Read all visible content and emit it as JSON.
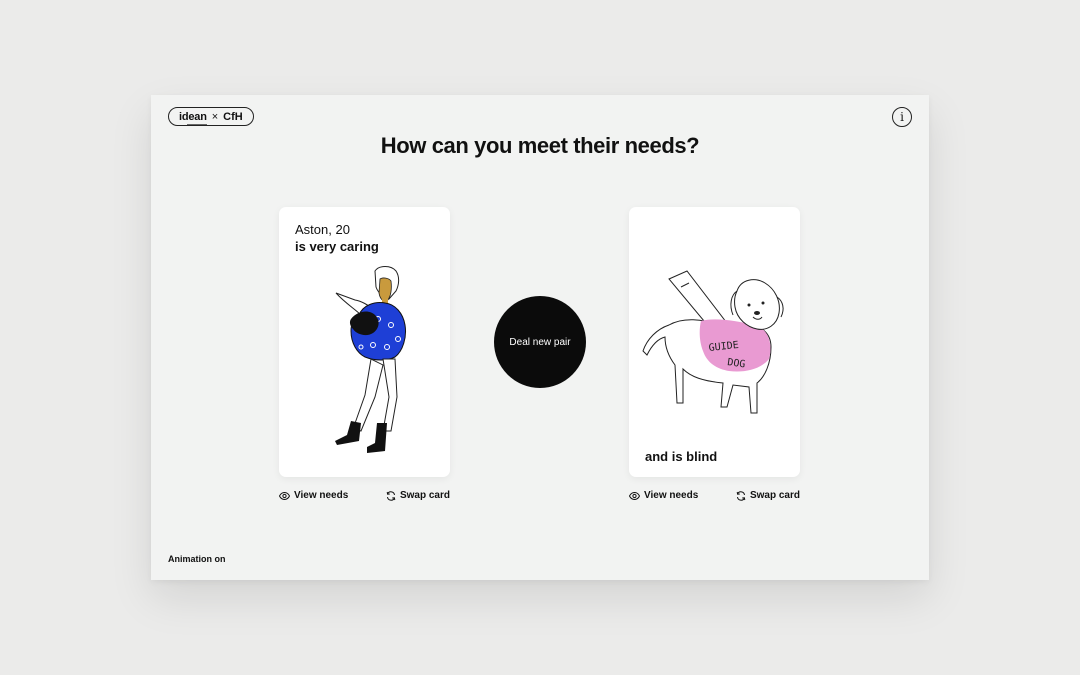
{
  "brand": {
    "left": "idean",
    "times": "×",
    "right": "CfH"
  },
  "info_label": "i",
  "title": "How can you meet their needs?",
  "left_card": {
    "name": "Aston, 20",
    "trait": "is very caring"
  },
  "right_card": {
    "need": "and is blind",
    "vest_line1": "GUIDE",
    "vest_line2": "DOG"
  },
  "deal_label": "Deal new pair",
  "actions": {
    "view_needs": "View needs",
    "swap_card": "Swap card"
  },
  "footer": {
    "animation": "Animation on"
  },
  "colors": {
    "sweater_blue": "#1e3fd6",
    "skin": "#c99a3d",
    "vest_pink": "#e99ad2",
    "black": "#0b0b0b"
  },
  "icons": {
    "view": "eye-icon",
    "swap": "refresh-icon",
    "info": "info-icon"
  }
}
